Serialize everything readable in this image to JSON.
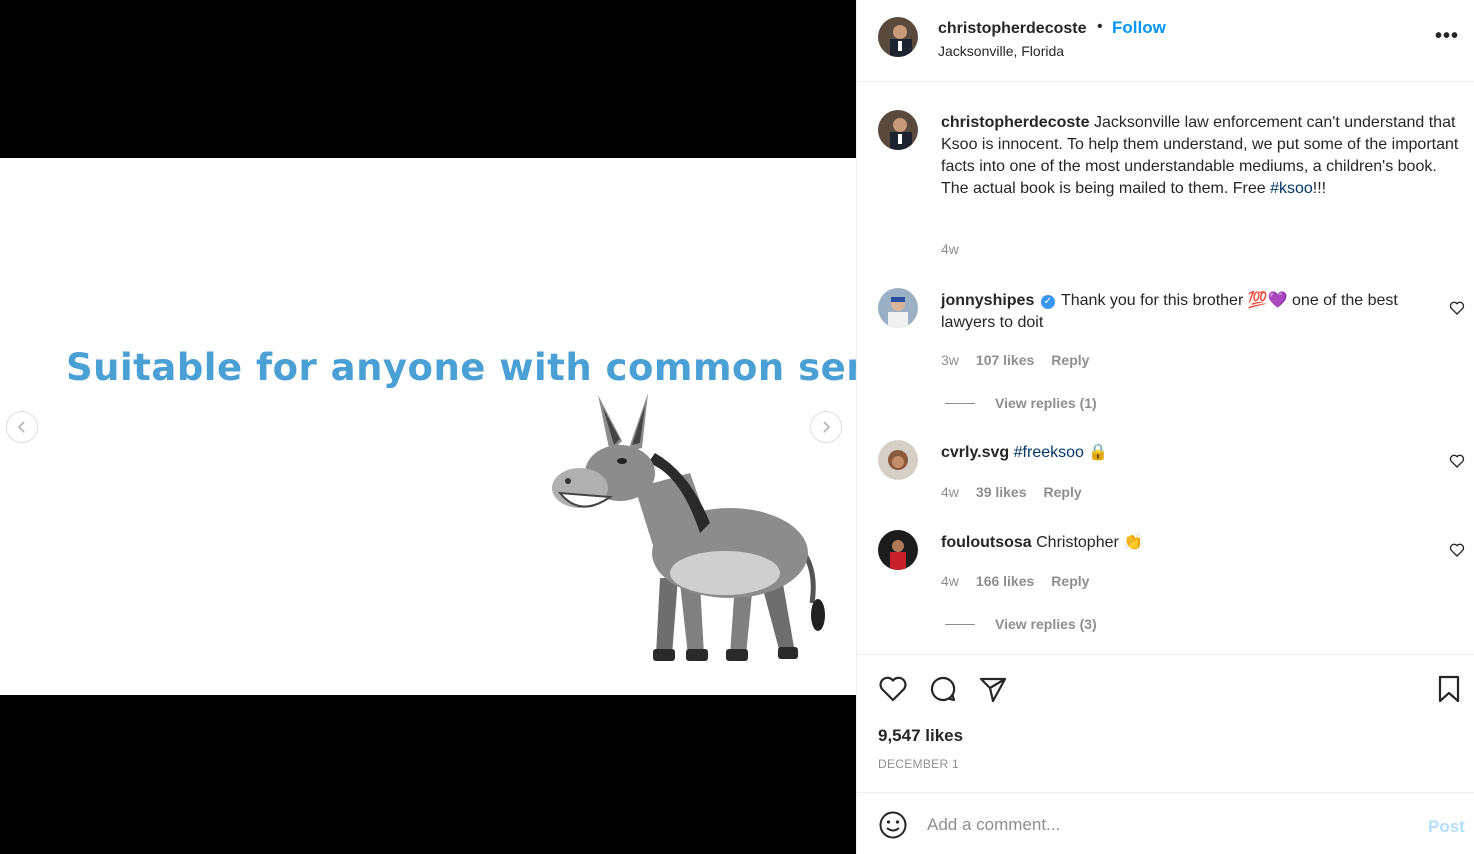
{
  "media": {
    "slide_text": "Suitable for anyone with common sense.",
    "caption_color": "#4a9fd4"
  },
  "header": {
    "username": "christopherdecoste",
    "separator": "•",
    "follow_label": "Follow",
    "location": "Jacksonville, Florida",
    "more_icon": "more-horizontal-icon"
  },
  "caption": {
    "username": "christopherdecoste",
    "text": "Jacksonville law enforcement can't understand that Ksoo is innocent. To help them understand, we put some of the important facts into one of the most understandable mediums, a children's book. The actual book is being mailed to them. Free ",
    "hashtag": "#ksoo",
    "suffix": "!!!",
    "time": "4w"
  },
  "comments": [
    {
      "username": "jonnyshipes",
      "verified": true,
      "text": "Thank you for this brother 💯💜 one of the best lawyers to doit",
      "time": "3w",
      "likes": "107 likes",
      "reply_label": "Reply",
      "view_replies": "View replies (1)"
    },
    {
      "username": "cvrly.svg",
      "hashtag": "#freeksoo",
      "text_after": " 🔒",
      "time": "4w",
      "likes": "39 likes",
      "reply_label": "Reply"
    },
    {
      "username": "fouloutsosa",
      "text": "Christopher 👏",
      "time": "4w",
      "likes": "166 likes",
      "reply_label": "Reply",
      "view_replies": "View replies (3)"
    }
  ],
  "actions": {
    "likes": "9,547 likes",
    "date": "DECEMBER 1"
  },
  "add_comment": {
    "placeholder": "Add a comment...",
    "post_label": "Post"
  },
  "colors": {
    "link_blue": "#0095f6",
    "hashtag": "#00376b",
    "muted": "#8e8e8e",
    "post_disabled": "#b2dffc"
  }
}
